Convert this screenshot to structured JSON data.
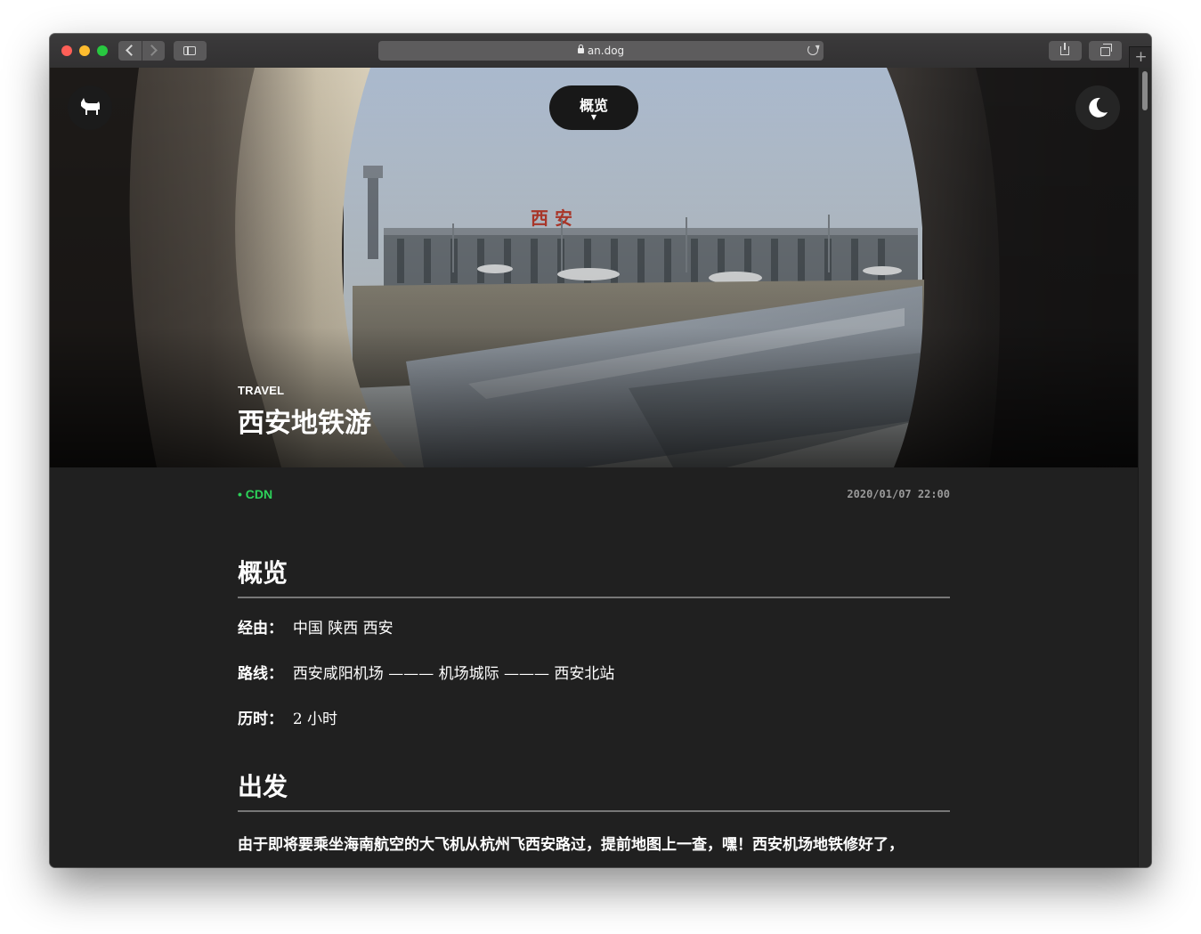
{
  "browser": {
    "url": "an.dog",
    "new_tab_label": "+"
  },
  "nav": {
    "toc_label": "概览",
    "toc_arrow": "▼",
    "logo_icon": "dog-icon",
    "theme_icon": "moon-icon"
  },
  "hero": {
    "category": "TRAVEL",
    "title": "西安地铁游",
    "scene_sign": "西 安"
  },
  "meta": {
    "tag": "• CDN",
    "date": "2020/01/07 22:00"
  },
  "sections": {
    "overview_heading": "概览",
    "via_label": "经由：",
    "via_value": "中国 陕西 西安",
    "route_label": "路线：",
    "route_value": "西安咸阳机场 ——— 机场城际 ——— 西安北站",
    "duration_label": "历时：",
    "duration_value": "2 小时",
    "depart_heading": "出发",
    "depart_paragraph": "由于即将要乘坐海南航空的大飞机从杭州飞西安路过，提前地图上一查，嘿！西安机场地铁修好了，"
  },
  "colors": {
    "page_bg": "#202020",
    "accent_tag": "#2dd35a",
    "date_text": "#9a9a9a"
  }
}
